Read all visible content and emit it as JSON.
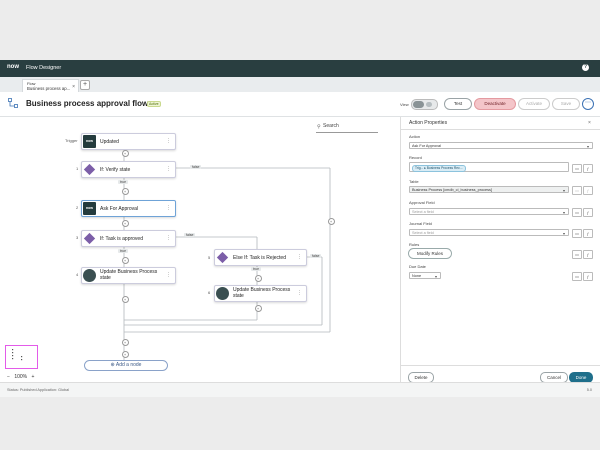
{
  "app": {
    "logo": "now",
    "title": "Flow Designer",
    "help_icon": "?"
  },
  "tab": {
    "type": "Flow",
    "name": "Business process ap...",
    "close": "×",
    "add": "+"
  },
  "header": {
    "title": "Business process approval flow",
    "badge": "Active",
    "view_label": "View",
    "buttons": {
      "test": "Test",
      "deactivate": "Deactivate",
      "activate": "Activate",
      "save": "Save",
      "more": "⋯"
    }
  },
  "canvas": {
    "search_placeholder": "Search",
    "trigger_label": "Trigger",
    "trigger": {
      "title": "Updated"
    },
    "nodes": [
      {
        "num": "1",
        "label": "If: Verify state"
      },
      {
        "num": "2",
        "label": "Ask For Approval"
      },
      {
        "num": "3",
        "label": "If: Task is approved"
      },
      {
        "num": "4",
        "label": "Update Business Process state"
      },
      {
        "num": "5",
        "label": "Else If: Task is Rejected"
      },
      {
        "num": "6",
        "label": "Update Business Process state"
      }
    ],
    "branch_labels": {
      "true": "true",
      "false": "false"
    },
    "add_node": "Add a node",
    "zoom": "100%",
    "zoom_minus": "−",
    "zoom_plus": "+"
  },
  "status": {
    "left": "Status: Published   Application: Global",
    "right": "5.0"
  },
  "panel": {
    "title": "Action Properties",
    "close": "×",
    "action_label": "Action",
    "action_value": "Ask For Approval",
    "record_label": "Record",
    "record_tag": "Trig... ▸ Business Process Rec...",
    "table_label": "Table",
    "table_value": "Business Process [cmdb_ci_business_process]",
    "approval_label": "Approval Field",
    "approval_ph": "Select a field",
    "journal_label": "Journal Field",
    "journal_ph": "Select a field",
    "rules_label": "Rules",
    "modify_rules": "Modify Rules",
    "due_label": "Due Date",
    "due_value": "None",
    "delete": "Delete",
    "cancel": "Cancel",
    "done": "Done"
  },
  "colors": {
    "topbar": "#293e40",
    "accent": "#1f6f8b",
    "decision": "#7c5ea8",
    "deactivate": "#f4c5c9"
  }
}
